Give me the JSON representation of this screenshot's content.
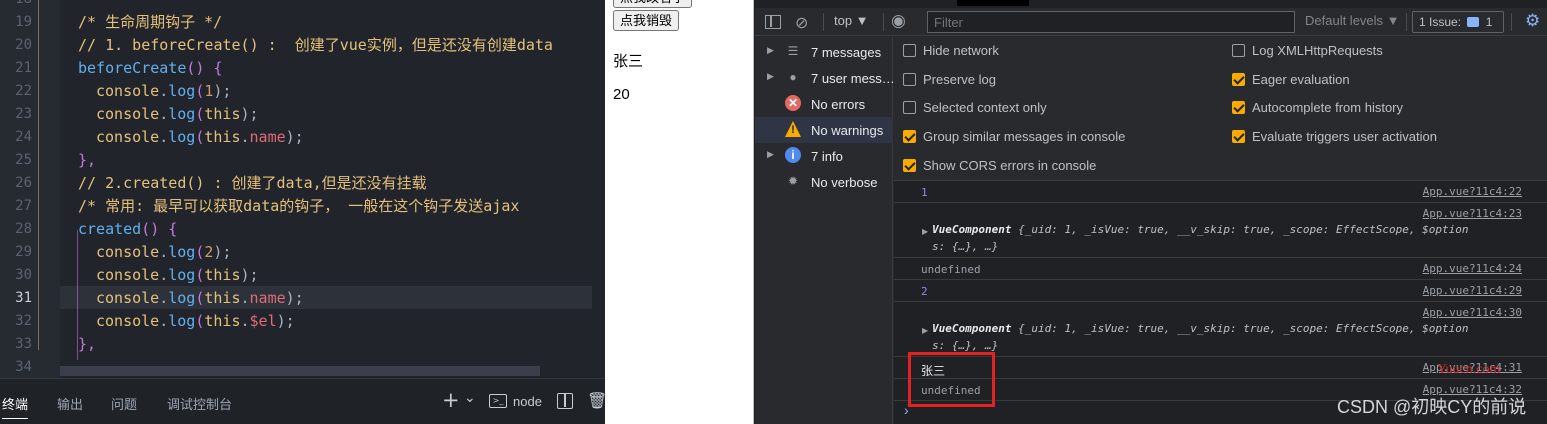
{
  "editor": {
    "line_numbers": [
      "18",
      "19",
      "20",
      "21",
      "22",
      "23",
      "24",
      "25",
      "26",
      "27",
      "28",
      "29",
      "30",
      "31",
      "32",
      "33",
      "34"
    ],
    "current_line": "31",
    "lines": [
      [
        {
          "t": "/* 生命周期钩子 */",
          "c": "cm"
        }
      ],
      [
        {
          "t": "// 1. beforeCreate() :  创建了vue实例，但是还没有创建data",
          "c": "cm"
        }
      ],
      [
        {
          "t": "beforeCreate",
          "c": "fn"
        },
        {
          "t": "() {",
          "c": "pu"
        }
      ],
      [
        {
          "t": "console",
          "c": "kw"
        },
        {
          "t": ".",
          "c": "pl"
        },
        {
          "t": "log",
          "c": "fn"
        },
        {
          "t": "(",
          "c": "pu"
        },
        {
          "t": "1",
          "c": "nm"
        },
        {
          "t": ");",
          "c": "pl"
        }
      ],
      [
        {
          "t": "console",
          "c": "kw"
        },
        {
          "t": ".",
          "c": "pl"
        },
        {
          "t": "log",
          "c": "fn"
        },
        {
          "t": "(",
          "c": "pu"
        },
        {
          "t": "this",
          "c": "kw"
        },
        {
          "t": ");",
          "c": "pl"
        }
      ],
      [
        {
          "t": "console",
          "c": "kw"
        },
        {
          "t": ".",
          "c": "pl"
        },
        {
          "t": "log",
          "c": "fn"
        },
        {
          "t": "(",
          "c": "pu"
        },
        {
          "t": "this",
          "c": "kw"
        },
        {
          "t": ".",
          "c": "pl"
        },
        {
          "t": "name",
          "c": "tx"
        },
        {
          "t": ");",
          "c": "pl"
        }
      ],
      [
        {
          "t": "},",
          "c": "pu"
        }
      ],
      [
        {
          "t": "// 2.created() : 创建了data,但是还没有挂载",
          "c": "cm"
        }
      ],
      [
        {
          "t": "/* 常用: 最早可以获取data的钩子， 一般在这个钩子发送ajax",
          "c": "cm"
        }
      ],
      [
        {
          "t": "created",
          "c": "fn"
        },
        {
          "t": "() {",
          "c": "pu"
        }
      ],
      [
        {
          "t": "console",
          "c": "kw"
        },
        {
          "t": ".",
          "c": "pl"
        },
        {
          "t": "log",
          "c": "fn"
        },
        {
          "t": "(",
          "c": "pu"
        },
        {
          "t": "2",
          "c": "nm"
        },
        {
          "t": ");",
          "c": "pl"
        }
      ],
      [
        {
          "t": "console",
          "c": "kw"
        },
        {
          "t": ".",
          "c": "pl"
        },
        {
          "t": "log",
          "c": "fn"
        },
        {
          "t": "(",
          "c": "pu"
        },
        {
          "t": "this",
          "c": "kw"
        },
        {
          "t": ");",
          "c": "pl"
        }
      ],
      [
        {
          "t": "console",
          "c": "kw"
        },
        {
          "t": ".",
          "c": "pl"
        },
        {
          "t": "log",
          "c": "fn"
        },
        {
          "t": "(",
          "c": "pu"
        },
        {
          "t": "this",
          "c": "kw"
        },
        {
          "t": ".",
          "c": "pl"
        },
        {
          "t": "name",
          "c": "tx"
        },
        {
          "t": ");",
          "c": "pl"
        }
      ],
      [
        {
          "t": "console",
          "c": "kw"
        },
        {
          "t": ".",
          "c": "pl"
        },
        {
          "t": "log",
          "c": "fn"
        },
        {
          "t": "(",
          "c": "pu"
        },
        {
          "t": "this",
          "c": "kw"
        },
        {
          "t": ".",
          "c": "pl"
        },
        {
          "t": "$el",
          "c": "tx"
        },
        {
          "t": ");",
          "c": "pl"
        }
      ],
      [
        {
          "t": "},",
          "c": "pu"
        }
      ],
      [
        {
          "t": "",
          "c": "pl"
        }
      ]
    ]
  },
  "panel": {
    "tabs": [
      "终端",
      "输出",
      "问题",
      "调试控制台"
    ],
    "active": "终端",
    "add": "+",
    "chevron": "⌄",
    "shell": "node"
  },
  "preview": {
    "button_top": "点我改名字",
    "button_destroy": "点我销毁",
    "name": "张三",
    "age": "20"
  },
  "devtools": {
    "context": "top ▼",
    "filter_placeholder": "Filter",
    "levels": "Default levels ▼",
    "issues_label": "1 Issue:",
    "issues_count": "1",
    "sidebar": [
      {
        "label": "7 messages",
        "icon": "list-icon",
        "arrow": "▶"
      },
      {
        "label": "7 user mess…",
        "icon": "user-icon",
        "arrow": "▶"
      },
      {
        "label": "No errors",
        "icon": "error-icon",
        "arrow": ""
      },
      {
        "label": "No warnings",
        "icon": "warning-icon",
        "arrow": ""
      },
      {
        "label": "7 info",
        "icon": "info-icon",
        "arrow": "▶"
      },
      {
        "label": "No verbose",
        "icon": "bug-icon",
        "arrow": ""
      }
    ],
    "settings_left": [
      {
        "label": "Hide network",
        "checked": false
      },
      {
        "label": "Preserve log",
        "checked": false
      },
      {
        "label": "Selected context only",
        "checked": false
      },
      {
        "label": "Group similar messages in console",
        "checked": true
      },
      {
        "label": "Show CORS errors in console",
        "checked": true
      }
    ],
    "settings_right": [
      {
        "label": "Log XMLHttpRequests",
        "checked": false
      },
      {
        "label": "Eager evaluation",
        "checked": true
      },
      {
        "label": "Autocomplete from history",
        "checked": true
      },
      {
        "label": "Evaluate triggers user activation",
        "checked": true
      }
    ],
    "console_rows": [
      {
        "kind": "number",
        "value": "1",
        "source": "App.vue?11c4:22"
      },
      {
        "kind": "object",
        "prefix": "VueComponent",
        "body": " {_uid: 1, _isVue: true, __v_skip: true, _scope: EffectScope, $option",
        "cont": "s: {…}, …}",
        "source": "App.vue?11c4:23"
      },
      {
        "kind": "undefined",
        "value": "undefined",
        "source": "App.vue?11c4:24"
      },
      {
        "kind": "number",
        "value": "2",
        "source": "App.vue?11c4:29"
      },
      {
        "kind": "object",
        "prefix": "VueComponent",
        "body": " {_uid: 1, _isVue: true, __v_skip: true, _scope: EffectScope, $option",
        "cont": "s: {…}, …}",
        "source": "App.vue?11c4:30"
      },
      {
        "kind": "string",
        "value": "张三",
        "source": "App.vue?11c4:31"
      },
      {
        "kind": "undefined",
        "value": "undefined",
        "source": "App.vue?11c4:32"
      }
    ],
    "prompt": "›"
  },
  "watermark": "CSDN @初映CY的前说",
  "yuucn": "Yuucn.com"
}
